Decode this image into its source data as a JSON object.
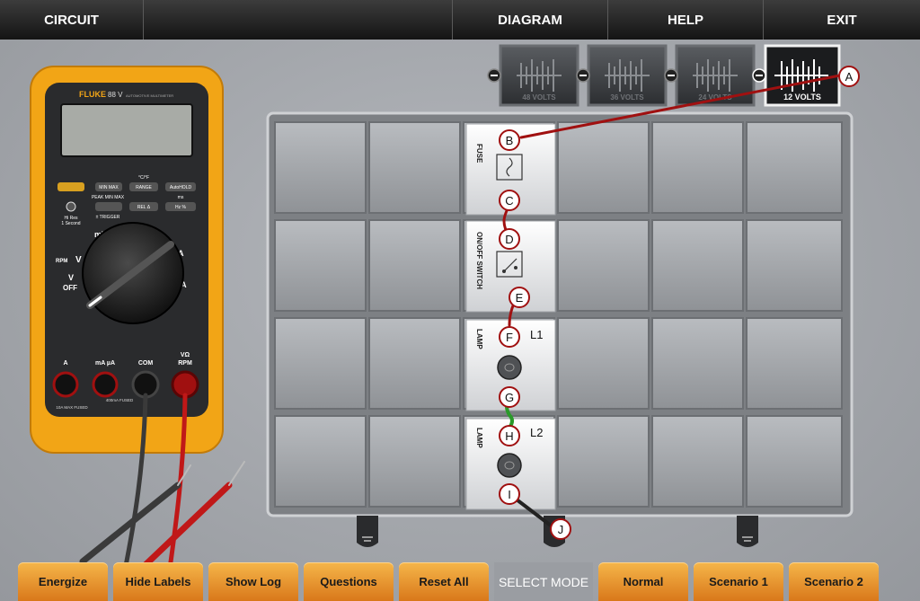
{
  "menu": {
    "circuit": "CIRCUIT",
    "diagram": "DIAGRAM",
    "help": "HELP",
    "exit": "EXIT"
  },
  "batteries": [
    {
      "label": "48 VOLTS",
      "active": false
    },
    {
      "label": "36 VOLTS",
      "active": false
    },
    {
      "label": "24 VOLTS",
      "active": false
    },
    {
      "label": "12 VOLTS",
      "active": true
    }
  ],
  "components": {
    "fuse": "FUSE",
    "switch": "ON/OFF SWITCH",
    "lamp1": "LAMP",
    "lamp1_id": "L1",
    "lamp2": "LAMP",
    "lamp2_id": "L2"
  },
  "test_points": [
    "A",
    "B",
    "C",
    "D",
    "E",
    "F",
    "G",
    "H",
    "I",
    "J"
  ],
  "multimeter": {
    "brand": "FLUKE",
    "model": "88 V",
    "subtitle": "AUTOMOTIVE MULTIMETER",
    "btn_minmax": "MIN MAX",
    "btn_range": "RANGE",
    "btn_autohold": "AutoHOLD",
    "btn_rel": "REL Δ",
    "btn_hz": "Hz %",
    "lbl_cf": "°C/°F",
    "lbl_peak": "PEAK MIN MAX",
    "lbl_ms": "ms",
    "lbl_trigger": "± TRIGGER",
    "lbl_hires": "Hi Res",
    "lbl_1sec": "1 Second",
    "dial_off": "OFF",
    "dial_v": "V",
    "dial_mv": "mV",
    "dial_rpm": "RPM",
    "dial_ma": "mA",
    "dial_ua": "µA",
    "jack_a": "A",
    "jack_ma": "mA µA",
    "jack_com": "COM",
    "jack_v": "VΩ",
    "jack_rpm": "RPM",
    "fuse_note1": "10A MAX FUSED",
    "fuse_note2": "400mA FUSED"
  },
  "bottom": {
    "energize": "Energize",
    "hide_labels": "Hide Labels",
    "show_log": "Show Log",
    "questions": "Questions",
    "reset_all": "Reset All",
    "select_mode": "SELECT MODE",
    "normal": "Normal",
    "scenario1": "Scenario 1",
    "scenario2": "Scenario 2"
  },
  "colors": {
    "accent_orange": "#e8952e",
    "wire_red": "#a01010",
    "wire_green": "#2a9a2a",
    "wire_black": "#222222",
    "meter_yellow": "#f2a516"
  }
}
